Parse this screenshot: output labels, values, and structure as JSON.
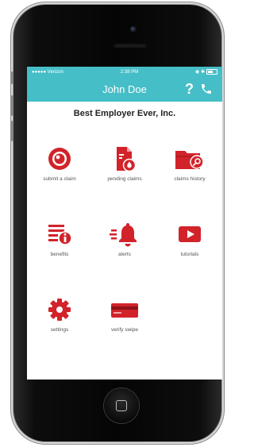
{
  "status": {
    "carrier": "●●●●● Verizon",
    "time": "2:38 PM"
  },
  "header": {
    "title": "John Doe",
    "help_label": "?"
  },
  "company": "Best Employer Ever, Inc.",
  "accent_color": "#d2232a",
  "bar_color": "#46bec8",
  "menu": [
    {
      "label": "submit a claim",
      "icon": "target-circle-icon"
    },
    {
      "label": "pending claims",
      "icon": "document-drop-icon"
    },
    {
      "label": "claims history",
      "icon": "folder-search-icon"
    },
    {
      "label": "benefits",
      "icon": "list-info-icon"
    },
    {
      "label": "alerts",
      "icon": "bell-icon"
    },
    {
      "label": "tutorials",
      "icon": "play-icon"
    },
    {
      "label": "settings",
      "icon": "gear-icon"
    },
    {
      "label": "verify swipe",
      "icon": "card-icon"
    }
  ]
}
